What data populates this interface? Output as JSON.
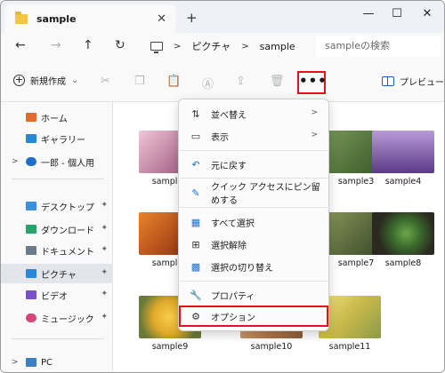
{
  "tab": {
    "title": "sample",
    "close": "✕",
    "new": "+"
  },
  "window": {
    "minimize": "—",
    "maximize": "☐",
    "close": "✕"
  },
  "nav": {
    "back": "←",
    "forward": "→",
    "up": "↑",
    "refresh": "↻"
  },
  "address": {
    "sep1": ">",
    "seg1": "ピクチャ",
    "sep2": ">",
    "seg2": "sample"
  },
  "search": {
    "placeholder": "sampleの検索"
  },
  "toolbar": {
    "new_label": "新規作成",
    "new_chevron": "⌄",
    "more_label": "•••",
    "preview_label": "プレビュー"
  },
  "sidebar": {
    "items": [
      {
        "label": "ホーム"
      },
      {
        "label": "ギャラリー"
      },
      {
        "label": "一郎 - 個人用"
      },
      {
        "label": "デスクトップ"
      },
      {
        "label": "ダウンロード"
      },
      {
        "label": "ドキュメント"
      },
      {
        "label": "ピクチャ"
      },
      {
        "label": "ビデオ"
      },
      {
        "label": "ミュージック"
      },
      {
        "label": "PC"
      }
    ],
    "pin": "📌",
    "expand": ">"
  },
  "files": [
    {
      "name": "sample1",
      "color": "#c98aa8"
    },
    {
      "name": "sample3",
      "color": "#5a7a4a"
    },
    {
      "name": "sample4",
      "color": "#8a6aa8"
    },
    {
      "name": "sample5",
      "color": "#b8541c"
    },
    {
      "name": "sample7",
      "color": "#55603a"
    },
    {
      "name": "sample8",
      "color": "#3a4a2c"
    },
    {
      "name": "sample9",
      "color": "#e0b43a"
    },
    {
      "name": "sample10",
      "color": "#c78a56"
    },
    {
      "name": "sample11",
      "color": "#d6c86a"
    }
  ],
  "context_menu": {
    "sort": "並べ替え",
    "view": "表示",
    "undo": "元に戻す",
    "pin_quick_access": "クイック アクセスにピン留めする",
    "select_all": "すべて選択",
    "select_none": "選択解除",
    "invert_selection": "選択の切り替え",
    "properties": "プロパティ",
    "options": "オプション",
    "submenu_arrow": ">"
  },
  "colors": {
    "highlight_red": "#e8101c",
    "accent_blue": "#1a6fd0"
  }
}
